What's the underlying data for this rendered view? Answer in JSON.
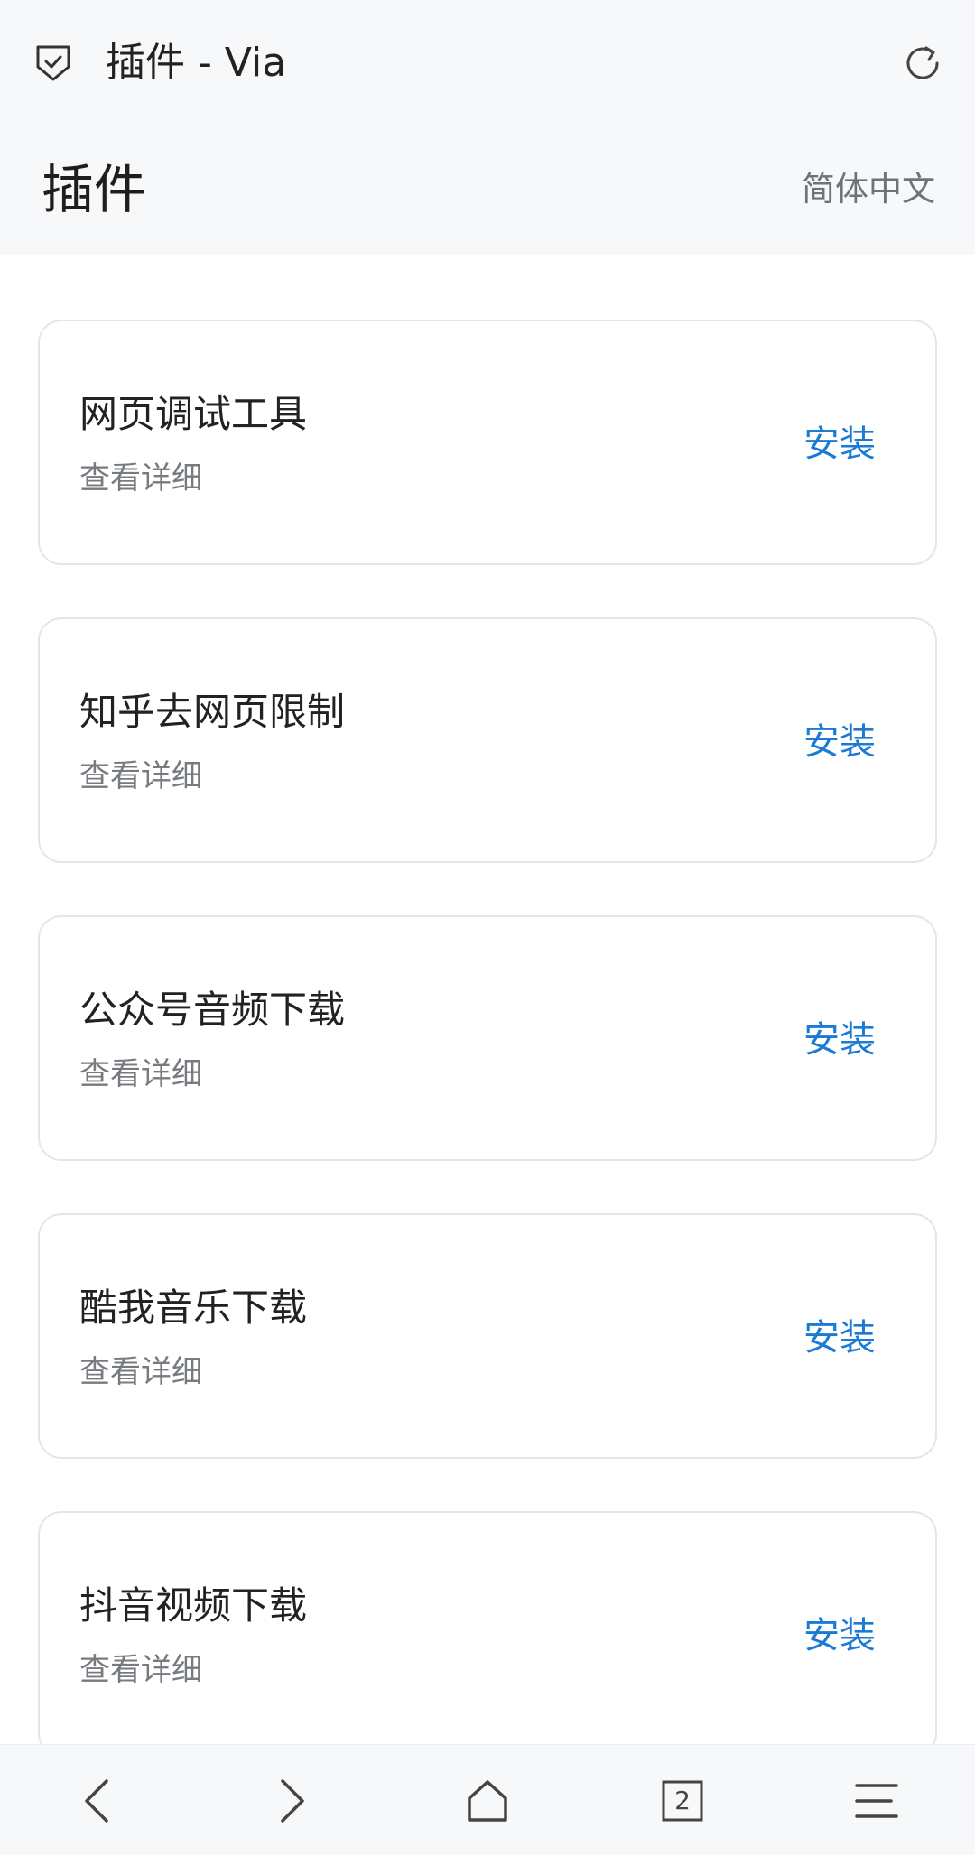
{
  "topbar": {
    "title": "插件 - Via",
    "security_icon": "shield-check-icon",
    "refresh_icon": "refresh-icon"
  },
  "header": {
    "title": "插件",
    "language": "简体中文"
  },
  "plugins": [
    {
      "name": "网页调试工具",
      "detail": "查看详细",
      "action": "安装"
    },
    {
      "name": "知乎去网页限制",
      "detail": "查看详细",
      "action": "安装"
    },
    {
      "name": "公众号音频下载",
      "detail": "查看详细",
      "action": "安装"
    },
    {
      "name": "酷我音乐下载",
      "detail": "查看详细",
      "action": "安装"
    },
    {
      "name": "抖音视频下载",
      "detail": "查看详细",
      "action": "安装"
    }
  ],
  "bottombar": {
    "tab_count": "2",
    "icons": [
      "back-icon",
      "forward-icon",
      "home-icon",
      "tabs-icon",
      "menu-icon"
    ]
  },
  "colors": {
    "accent": "#1a7ad4",
    "bar_background": "#f7f8fa",
    "card_border": "#e3e5e8"
  }
}
